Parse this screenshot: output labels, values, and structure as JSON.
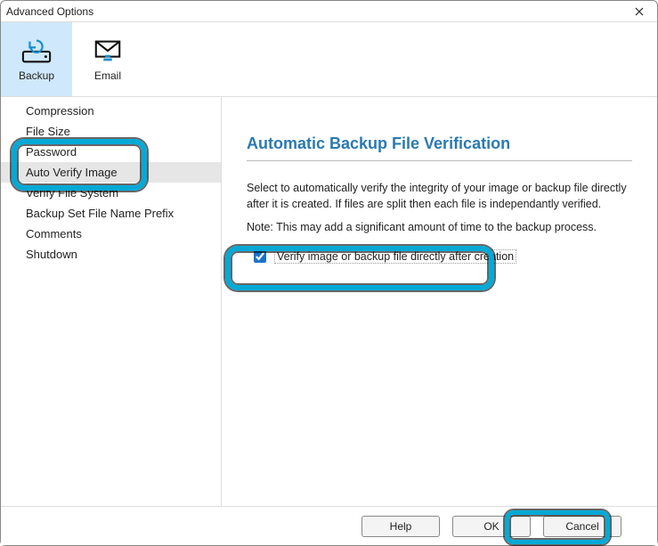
{
  "window": {
    "title": "Advanced Options"
  },
  "tabs": {
    "backup": "Backup",
    "email": "Email"
  },
  "sidebar": {
    "items": [
      "Compression",
      "File Size",
      "Password",
      "Auto Verify Image",
      "Verify File System",
      "Backup Set File Name Prefix",
      "Comments",
      "Shutdown"
    ],
    "selected_index": 3
  },
  "panel": {
    "heading": "Automatic Backup File Verification",
    "description": "Select to automatically verify the integrity of your image or backup file directly after it is created. If files are split then each file is independantly verified.",
    "note": "Note: This may add a significant amount of time to the backup process.",
    "checkbox_label": "Verify image or backup file directly after creation",
    "checkbox_checked": true
  },
  "buttons": {
    "help": "Help",
    "ok": "OK",
    "cancel": "Cancel"
  }
}
